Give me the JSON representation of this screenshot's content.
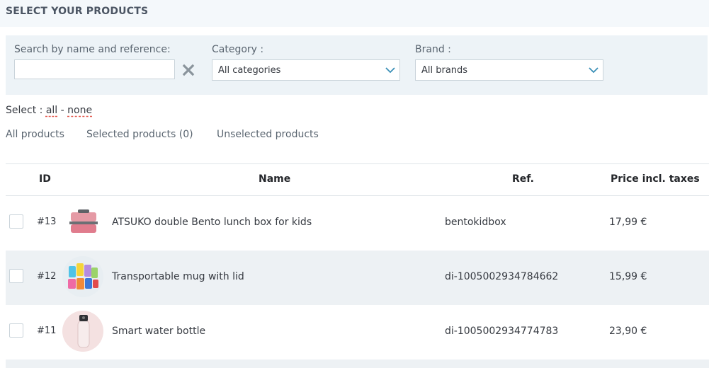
{
  "page": {
    "title": "SELECT YOUR PRODUCTS"
  },
  "filters": {
    "search_label": "Search by name and reference:",
    "search_value": "",
    "category_label": "Category :",
    "category_value": "All categories",
    "brand_label": "Brand :",
    "brand_value": "All brands"
  },
  "selection": {
    "prefix": "Select :",
    "all": "all",
    "separator": "-",
    "none": "none"
  },
  "tabs": [
    "All products",
    "Selected products (0)",
    "Unselected products"
  ],
  "table": {
    "headers": {
      "id": "ID",
      "name": "Name",
      "ref": "Ref.",
      "price": "Price incl. taxes"
    },
    "rows": [
      {
        "id": "#13",
        "name": "ATSUKO double Bento lunch box for kids",
        "ref": "bentokidbox",
        "price": "17,99 €",
        "thumb": "bento-box-icon"
      },
      {
        "id": "#12",
        "name": "Transportable mug with lid",
        "ref": "di-1005002934784662",
        "price": "15,99 €",
        "thumb": "mugs-icon"
      },
      {
        "id": "#11",
        "name": "Smart water bottle",
        "ref": "di-1005002934774783",
        "price": "23,90 €",
        "thumb": "bottle-icon"
      }
    ]
  },
  "colors": {
    "accent_underline": "#e2574c",
    "header_bg": "#f4f8fb",
    "filter_bg": "#edf3f7",
    "alt_row_bg": "#edf1f4"
  }
}
